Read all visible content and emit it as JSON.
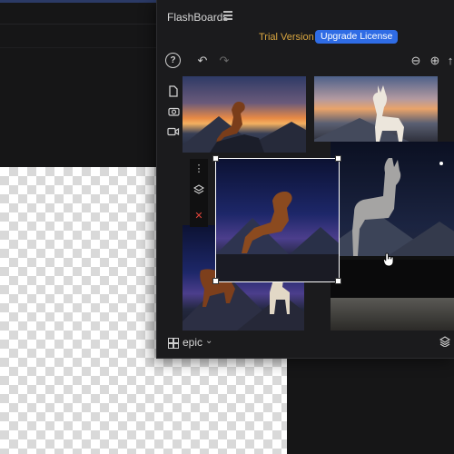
{
  "app": {
    "title": "FlashBoards"
  },
  "license": {
    "trial_label": "Trial Version",
    "upgrade_label": "Upgrade License"
  },
  "toolbar": {
    "help_glyph": "?",
    "undo_glyph": "↶",
    "redo_glyph": "↷",
    "zoom_out_glyph": "⊖",
    "zoom_in_glyph": "⊕"
  },
  "sidebar": {
    "items": [
      "document-icon",
      "camera-icon",
      "video-icon"
    ]
  },
  "context_menu": {
    "items": [
      "more-icon",
      "layers-icon",
      "delete-icon"
    ],
    "delete_glyph": "✕"
  },
  "board": {
    "name": "epic"
  },
  "colors": {
    "accent": "#2f6ce5",
    "trial": "#d9a640",
    "delete": "#e0443a"
  },
  "images": [
    {
      "name": "dog-sunset",
      "subject": "golden retriever on mountain at sunset"
    },
    {
      "name": "llama-dawn",
      "subject": "white llama at dawn"
    },
    {
      "name": "llama-night",
      "subject": "llama under night sky with stars"
    },
    {
      "name": "dog-night-selected",
      "subject": "golden retriever on cliff at night"
    },
    {
      "name": "dog-llama-night",
      "subject": "dog and llama on mountain path"
    }
  ]
}
